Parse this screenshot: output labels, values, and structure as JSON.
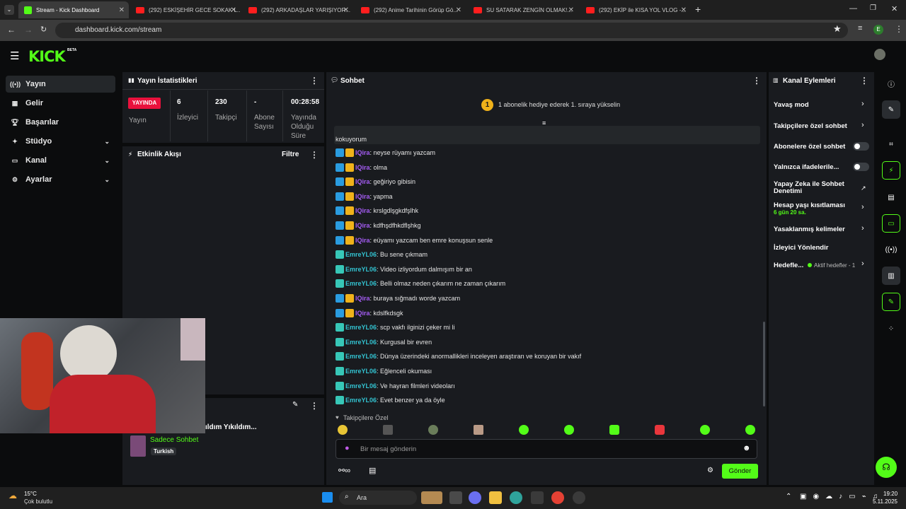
{
  "browser": {
    "tabs": [
      {
        "title": "Stream - Kick Dashboard",
        "active": true
      },
      {
        "title": "(292) ESKİŞEHİR GECE SOKAK L..."
      },
      {
        "title": "(292) ARKADAŞLAR YARIŞIYOR..."
      },
      {
        "title": "(292) Anime Tarihinin Görüp Gö..."
      },
      {
        "title": "SU SATARAK ZENGİN OLMAK!..."
      },
      {
        "title": "(292) EKİP ile KISA YOL VLOG -..."
      }
    ],
    "new_tab": "+",
    "url": "dashboard.kick.com/stream",
    "profile_initial": "E"
  },
  "kick": {
    "logo": "KICK",
    "beta": "BETA"
  },
  "sidebar": {
    "items": [
      {
        "label": "Yayın",
        "icon": "broadcast-icon"
      },
      {
        "label": "Gelir",
        "icon": "revenue-icon"
      },
      {
        "label": "Başarılar",
        "icon": "trophy-icon"
      },
      {
        "label": "Stüdyo",
        "icon": "studio-icon"
      },
      {
        "label": "Kanal",
        "icon": "channel-icon"
      },
      {
        "label": "Ayarlar",
        "icon": "gear-icon"
      }
    ]
  },
  "stats": {
    "title": "Yayın İstatistikleri",
    "live_badge": "YAYINDA",
    "live_label": "Yayın",
    "viewers_value": "6",
    "viewers_label": "İzleyici",
    "followers_value": "230",
    "followers_label": "Takipçi",
    "subs_value": "-",
    "subs_label": "Abone Sayısı",
    "uptime_value": "00:28:58",
    "uptime_label": "Yayında Olduğu Süre"
  },
  "activity": {
    "title": "Etkinlik Akışı",
    "filter": "Filtre"
  },
  "stream_preview": {
    "title_fragment": "ıldım Yıkıldım...",
    "category": "Sadece Sohbet",
    "language_tag": "Turkish"
  },
  "chat": {
    "title": "Sohbet",
    "banner_badge": "1",
    "banner_text": "1 abonelik hediye ederek 1. sıraya yükselin",
    "truncated_line": "kokuyorum",
    "messages": [
      {
        "user": "IQira",
        "text": ": neyse rüyamı yazcam"
      },
      {
        "user": "IQira",
        "text": ": olma"
      },
      {
        "user": "IQira",
        "text": ": geğiriyo gibisin"
      },
      {
        "user": "IQira",
        "text": ": yapma"
      },
      {
        "user": "IQira",
        "text": ": krslgdlşgkdfşlhk"
      },
      {
        "user": "IQira",
        "text": ": kdfhşdfhkdflşhkg"
      },
      {
        "user": "IQira",
        "text": ": eüyamı yazcam ben emre konuşsun senle"
      },
      {
        "user": "EmreYL06",
        "text": ": Bu sene çıkmam"
      },
      {
        "user": "EmreYL06",
        "text": ": Video izliyordum dalmışım bir an"
      },
      {
        "user": "EmreYL06",
        "text": ": Belli olmaz neden çıkarım ne zaman çıkarım"
      },
      {
        "user": "IQira",
        "text": ": buraya sığmadı worde yazcam"
      },
      {
        "user": "IQira",
        "text": ": kdslfkdsgk"
      },
      {
        "user": "EmreYL06",
        "text": ": scp vakfı ilginizi çeker mi li"
      },
      {
        "user": "EmreYL06",
        "text": ": Kurgusal bir evren"
      },
      {
        "user": "EmreYL06",
        "text": ": Dünya üzerindeki anormallikleri inceleyen araştıran ve koruyan bir vakıf"
      },
      {
        "user": "EmreYL06",
        "text": ": Eğlenceli okuması"
      },
      {
        "user": "EmreYL06",
        "text": ": Ve hayran filmleri videoları"
      },
      {
        "user": "EmreYL06",
        "text": ": Evet benzer ya da öyle"
      }
    ],
    "followers_only": "Takipçilere Özel",
    "input_placeholder": "Bir mesaj gönderin",
    "send_label": "Gönder"
  },
  "channel_actions": {
    "title": "Kanal Eylemleri",
    "slow_mode": "Yavaş mod",
    "followers_chat": "Takipçilere özel sohbet",
    "subs_chat": "Abonelere özel sohbet",
    "emotes_only": "Yalnızca ifadelerile...",
    "ai_moderation": "Yapay Zeka ile Sohbet Denetimi",
    "account_age": "Hesap yaşı kısıtlaması",
    "account_age_value": "6 gün 20 sa.",
    "banned_words": "Yasaklanmış kelimeler",
    "redirect": "İzleyici Yönlendir",
    "goals": "Hedefle...",
    "goals_status": "Aktif hedefler - 1"
  },
  "taskbar": {
    "temp": "15°C",
    "weather": "Çok bulutlu",
    "search": "Ara",
    "time": "19:20",
    "date": "5.11.2025"
  },
  "colors": {
    "kick_green": "#53fc18",
    "panel": "#191b1f",
    "live_red": "#e9113c"
  }
}
